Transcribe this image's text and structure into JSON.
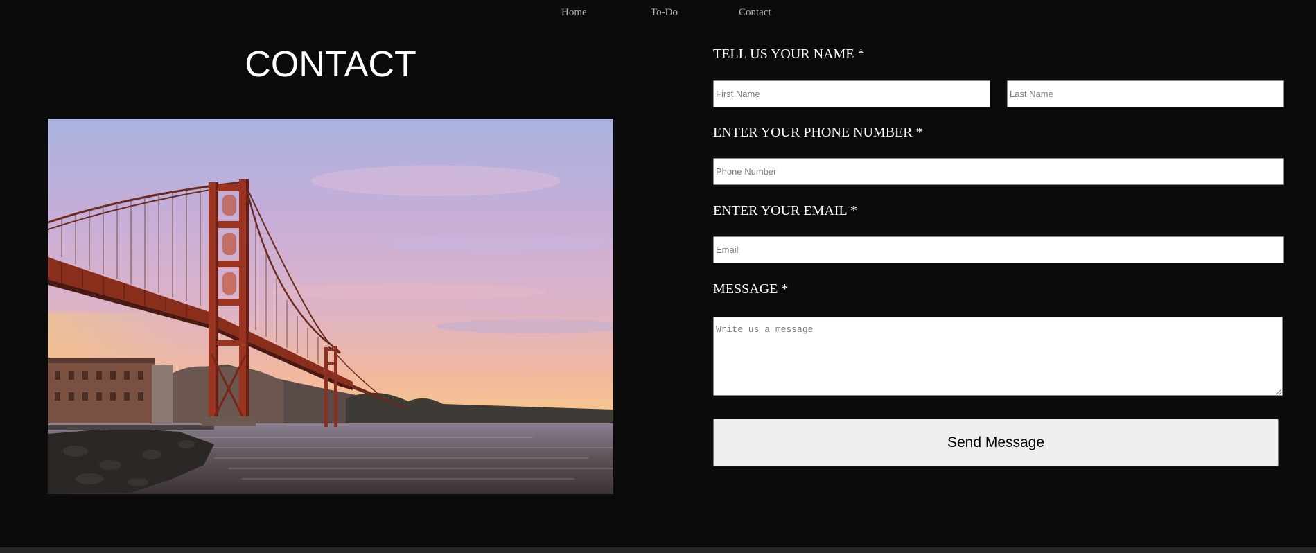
{
  "nav": {
    "home": "Home",
    "todo": "To-Do",
    "contact": "Contact"
  },
  "page": {
    "title": "CONTACT"
  },
  "form": {
    "name_label": "TELL US YOUR NAME *",
    "first_name_placeholder": "First Name",
    "last_name_placeholder": "Last Name",
    "phone_label": "ENTER YOUR PHONE NUMBER *",
    "phone_placeholder": "Phone Number",
    "email_label": "ENTER YOUR EMAIL *",
    "email_placeholder": "Email",
    "message_label": "MESSAGE *",
    "message_placeholder": "Write us a message",
    "send_label": "Send Message"
  },
  "colors": {
    "background": "#0b0b0b",
    "text": "#ffffff",
    "nav_text": "#b3b3b3",
    "button_bg": "#efefef"
  }
}
